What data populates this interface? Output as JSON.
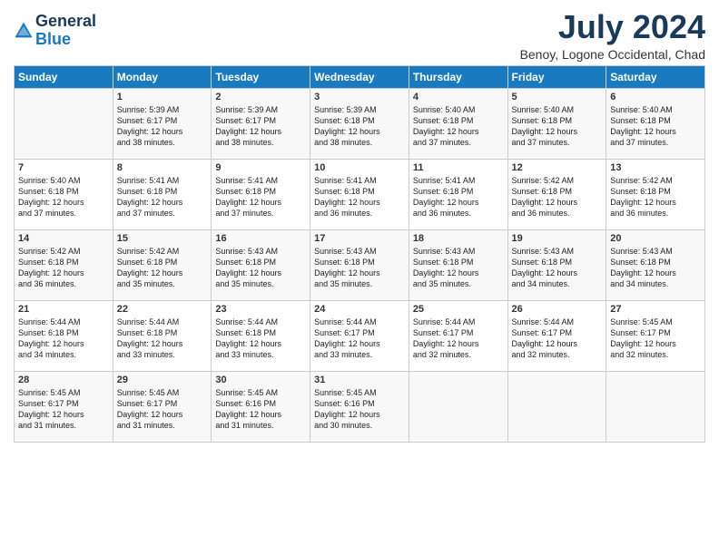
{
  "header": {
    "logo_general": "General",
    "logo_blue": "Blue",
    "month_title": "July 2024",
    "location": "Benoy, Logone Occidental, Chad"
  },
  "weekdays": [
    "Sunday",
    "Monday",
    "Tuesday",
    "Wednesday",
    "Thursday",
    "Friday",
    "Saturday"
  ],
  "weeks": [
    [
      {
        "num": "",
        "lines": []
      },
      {
        "num": "1",
        "lines": [
          "Sunrise: 5:39 AM",
          "Sunset: 6:17 PM",
          "Daylight: 12 hours",
          "and 38 minutes."
        ]
      },
      {
        "num": "2",
        "lines": [
          "Sunrise: 5:39 AM",
          "Sunset: 6:17 PM",
          "Daylight: 12 hours",
          "and 38 minutes."
        ]
      },
      {
        "num": "3",
        "lines": [
          "Sunrise: 5:39 AM",
          "Sunset: 6:18 PM",
          "Daylight: 12 hours",
          "and 38 minutes."
        ]
      },
      {
        "num": "4",
        "lines": [
          "Sunrise: 5:40 AM",
          "Sunset: 6:18 PM",
          "Daylight: 12 hours",
          "and 37 minutes."
        ]
      },
      {
        "num": "5",
        "lines": [
          "Sunrise: 5:40 AM",
          "Sunset: 6:18 PM",
          "Daylight: 12 hours",
          "and 37 minutes."
        ]
      },
      {
        "num": "6",
        "lines": [
          "Sunrise: 5:40 AM",
          "Sunset: 6:18 PM",
          "Daylight: 12 hours",
          "and 37 minutes."
        ]
      }
    ],
    [
      {
        "num": "7",
        "lines": [
          "Sunrise: 5:40 AM",
          "Sunset: 6:18 PM",
          "Daylight: 12 hours",
          "and 37 minutes."
        ]
      },
      {
        "num": "8",
        "lines": [
          "Sunrise: 5:41 AM",
          "Sunset: 6:18 PM",
          "Daylight: 12 hours",
          "and 37 minutes."
        ]
      },
      {
        "num": "9",
        "lines": [
          "Sunrise: 5:41 AM",
          "Sunset: 6:18 PM",
          "Daylight: 12 hours",
          "and 37 minutes."
        ]
      },
      {
        "num": "10",
        "lines": [
          "Sunrise: 5:41 AM",
          "Sunset: 6:18 PM",
          "Daylight: 12 hours",
          "and 36 minutes."
        ]
      },
      {
        "num": "11",
        "lines": [
          "Sunrise: 5:41 AM",
          "Sunset: 6:18 PM",
          "Daylight: 12 hours",
          "and 36 minutes."
        ]
      },
      {
        "num": "12",
        "lines": [
          "Sunrise: 5:42 AM",
          "Sunset: 6:18 PM",
          "Daylight: 12 hours",
          "and 36 minutes."
        ]
      },
      {
        "num": "13",
        "lines": [
          "Sunrise: 5:42 AM",
          "Sunset: 6:18 PM",
          "Daylight: 12 hours",
          "and 36 minutes."
        ]
      }
    ],
    [
      {
        "num": "14",
        "lines": [
          "Sunrise: 5:42 AM",
          "Sunset: 6:18 PM",
          "Daylight: 12 hours",
          "and 36 minutes."
        ]
      },
      {
        "num": "15",
        "lines": [
          "Sunrise: 5:42 AM",
          "Sunset: 6:18 PM",
          "Daylight: 12 hours",
          "and 35 minutes."
        ]
      },
      {
        "num": "16",
        "lines": [
          "Sunrise: 5:43 AM",
          "Sunset: 6:18 PM",
          "Daylight: 12 hours",
          "and 35 minutes."
        ]
      },
      {
        "num": "17",
        "lines": [
          "Sunrise: 5:43 AM",
          "Sunset: 6:18 PM",
          "Daylight: 12 hours",
          "and 35 minutes."
        ]
      },
      {
        "num": "18",
        "lines": [
          "Sunrise: 5:43 AM",
          "Sunset: 6:18 PM",
          "Daylight: 12 hours",
          "and 35 minutes."
        ]
      },
      {
        "num": "19",
        "lines": [
          "Sunrise: 5:43 AM",
          "Sunset: 6:18 PM",
          "Daylight: 12 hours",
          "and 34 minutes."
        ]
      },
      {
        "num": "20",
        "lines": [
          "Sunrise: 5:43 AM",
          "Sunset: 6:18 PM",
          "Daylight: 12 hours",
          "and 34 minutes."
        ]
      }
    ],
    [
      {
        "num": "21",
        "lines": [
          "Sunrise: 5:44 AM",
          "Sunset: 6:18 PM",
          "Daylight: 12 hours",
          "and 34 minutes."
        ]
      },
      {
        "num": "22",
        "lines": [
          "Sunrise: 5:44 AM",
          "Sunset: 6:18 PM",
          "Daylight: 12 hours",
          "and 33 minutes."
        ]
      },
      {
        "num": "23",
        "lines": [
          "Sunrise: 5:44 AM",
          "Sunset: 6:18 PM",
          "Daylight: 12 hours",
          "and 33 minutes."
        ]
      },
      {
        "num": "24",
        "lines": [
          "Sunrise: 5:44 AM",
          "Sunset: 6:17 PM",
          "Daylight: 12 hours",
          "and 33 minutes."
        ]
      },
      {
        "num": "25",
        "lines": [
          "Sunrise: 5:44 AM",
          "Sunset: 6:17 PM",
          "Daylight: 12 hours",
          "and 32 minutes."
        ]
      },
      {
        "num": "26",
        "lines": [
          "Sunrise: 5:44 AM",
          "Sunset: 6:17 PM",
          "Daylight: 12 hours",
          "and 32 minutes."
        ]
      },
      {
        "num": "27",
        "lines": [
          "Sunrise: 5:45 AM",
          "Sunset: 6:17 PM",
          "Daylight: 12 hours",
          "and 32 minutes."
        ]
      }
    ],
    [
      {
        "num": "28",
        "lines": [
          "Sunrise: 5:45 AM",
          "Sunset: 6:17 PM",
          "Daylight: 12 hours",
          "and 31 minutes."
        ]
      },
      {
        "num": "29",
        "lines": [
          "Sunrise: 5:45 AM",
          "Sunset: 6:17 PM",
          "Daylight: 12 hours",
          "and 31 minutes."
        ]
      },
      {
        "num": "30",
        "lines": [
          "Sunrise: 5:45 AM",
          "Sunset: 6:16 PM",
          "Daylight: 12 hours",
          "and 31 minutes."
        ]
      },
      {
        "num": "31",
        "lines": [
          "Sunrise: 5:45 AM",
          "Sunset: 6:16 PM",
          "Daylight: 12 hours",
          "and 30 minutes."
        ]
      },
      {
        "num": "",
        "lines": []
      },
      {
        "num": "",
        "lines": []
      },
      {
        "num": "",
        "lines": []
      }
    ]
  ]
}
